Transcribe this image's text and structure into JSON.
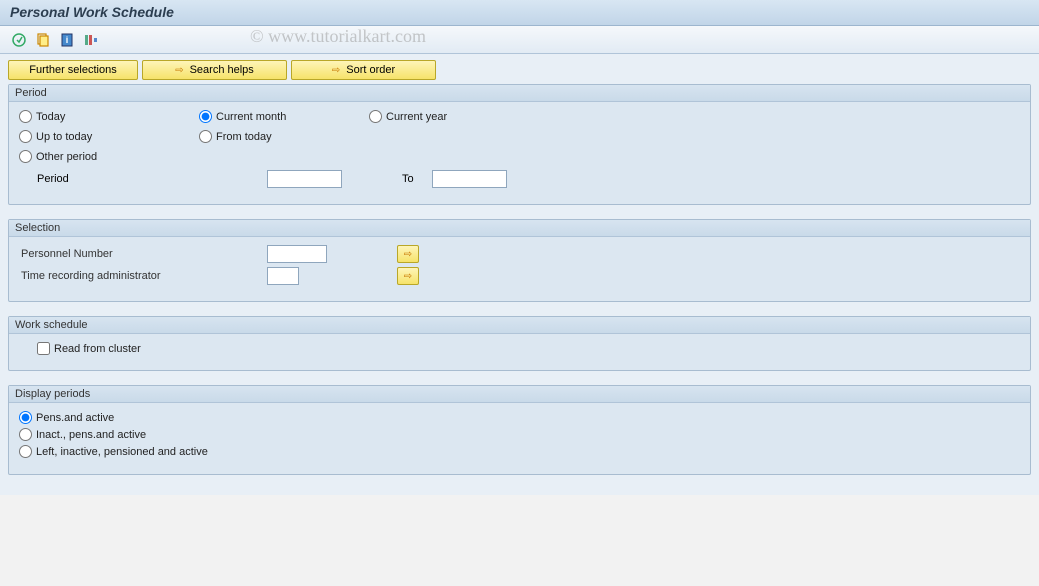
{
  "title": "Personal Work Schedule",
  "watermark": "© www.tutorialkart.com",
  "toolbar_buttons": {
    "further_selections": "Further selections",
    "search_helps": "Search helps",
    "sort_order": "Sort order"
  },
  "groups": {
    "period": {
      "title": "Period",
      "options": {
        "today": "Today",
        "current_month": "Current month",
        "current_year": "Current year",
        "up_to_today": "Up to today",
        "from_today": "From today",
        "other_period": "Other period"
      },
      "selected": "current_month",
      "period_label": "Period",
      "to_label": "To",
      "period_from": "",
      "period_to": ""
    },
    "selection": {
      "title": "Selection",
      "personnel_number_label": "Personnel Number",
      "personnel_number_value": "",
      "time_admin_label": "Time recording administrator",
      "time_admin_value": ""
    },
    "work_schedule": {
      "title": "Work schedule",
      "read_from_cluster_label": "Read from cluster",
      "read_from_cluster_checked": false
    },
    "display_periods": {
      "title": "Display periods",
      "options": {
        "pens_active": "Pens.and active",
        "inact_pens_active": "Inact., pens.and active",
        "left_inactive": "Left, inactive, pensioned and active"
      },
      "selected": "pens_active"
    }
  }
}
